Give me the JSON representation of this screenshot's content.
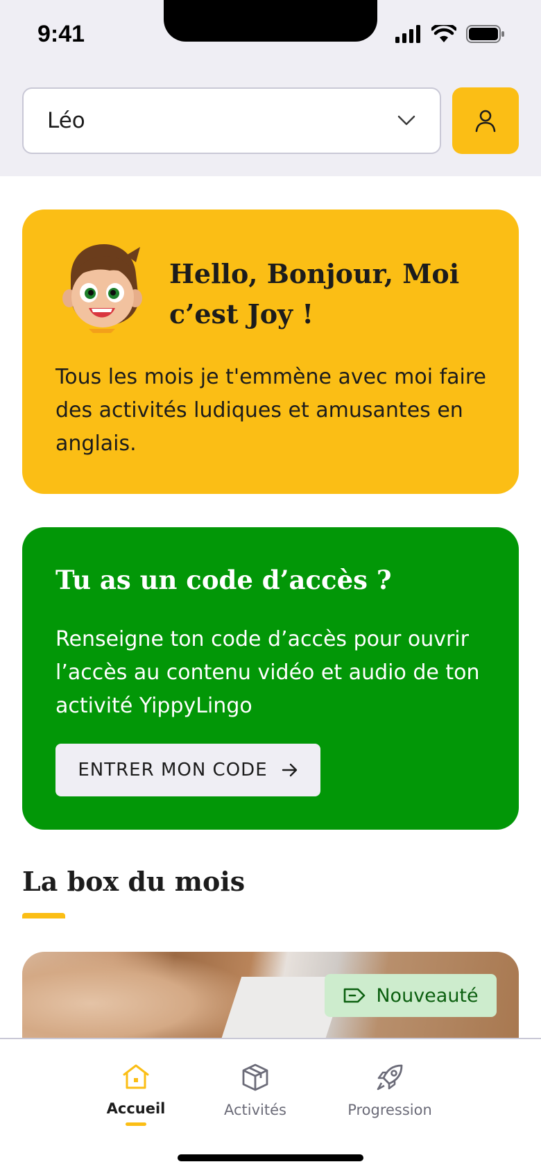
{
  "status_bar": {
    "time": "9:41"
  },
  "header": {
    "child_select": {
      "value": "Léo",
      "icon": "chevron-down-icon"
    },
    "profile_button": {
      "icon": "user-icon"
    }
  },
  "welcome_card": {
    "mascot": "mascot-joy",
    "title": "Hello, Bonjour, Moi c’est Joy !",
    "text": "Tous les mois je t'emmène avec moi faire des activités ludiques et amusantes en anglais."
  },
  "access_code_card": {
    "title": "Tu as un code d’accès ?",
    "text": "Renseigne ton code d’accès pour ouvrir l’accès au contenu vidéo et audio de ton activité YippyLingo",
    "button_label": "ENTRER MON CODE",
    "button_icon": "arrow-right-icon"
  },
  "monthly_box": {
    "section_title": "La box du mois",
    "badge_label": "Nouveauté",
    "badge_icon": "tag-icon"
  },
  "bottom_nav": {
    "items": [
      {
        "label": "Accueil",
        "icon": "home-icon",
        "active": true
      },
      {
        "label": "Activités",
        "icon": "box-icon",
        "active": false
      },
      {
        "label": "Progression",
        "icon": "rocket-icon",
        "active": false
      }
    ]
  },
  "colors": {
    "yellow": "#fbbe15",
    "green": "#029707",
    "badge_bg": "#cdeccd",
    "background_gray": "#efeef4",
    "text_dark": "#1c1c1c"
  }
}
